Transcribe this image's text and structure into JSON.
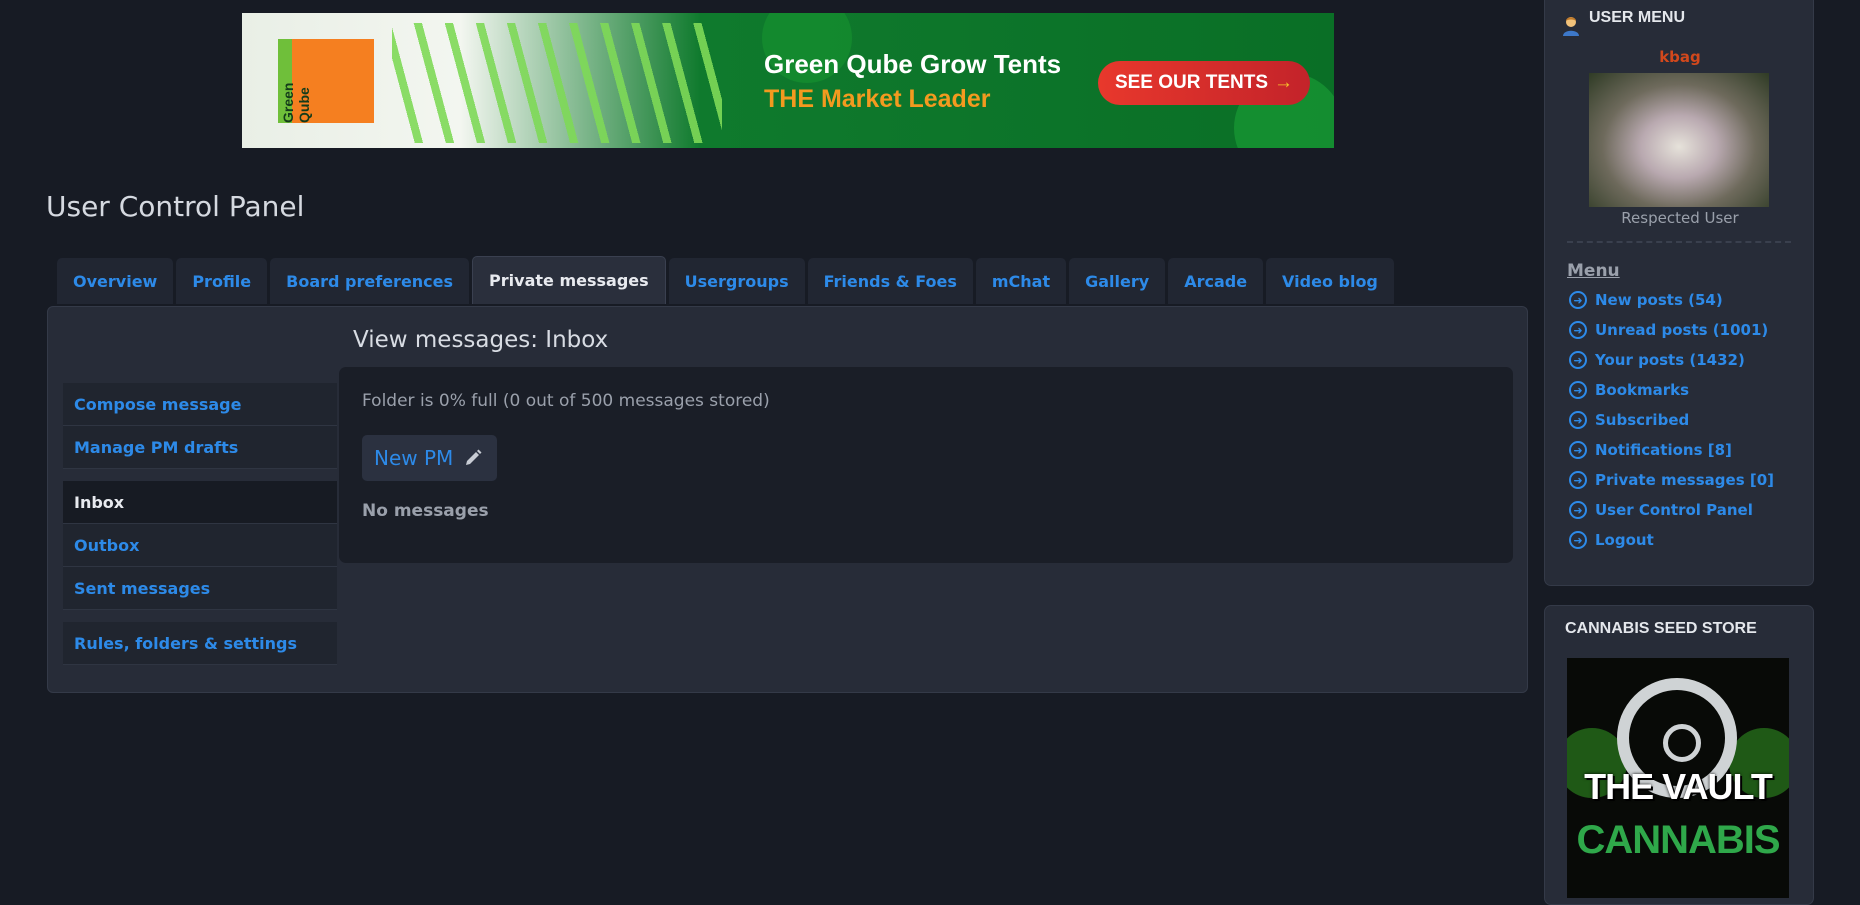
{
  "banner": {
    "logo_text": "Green Qube",
    "headline": "Green Qube Grow Tents",
    "subline": "THE Market Leader",
    "cta": "SEE OUR TENTS",
    "cta_arrow": "→"
  },
  "page": {
    "title": "User Control Panel"
  },
  "tabs": [
    {
      "label": "Overview"
    },
    {
      "label": "Profile"
    },
    {
      "label": "Board preferences"
    },
    {
      "label": "Private messages",
      "active": true
    },
    {
      "label": "Usergroups"
    },
    {
      "label": "Friends & Foes"
    },
    {
      "label": "mChat"
    },
    {
      "label": "Gallery"
    },
    {
      "label": "Arcade"
    },
    {
      "label": "Video blog"
    }
  ],
  "left_nav": {
    "group1": [
      "Compose message",
      "Manage PM drafts"
    ],
    "group2": [
      "Inbox",
      "Outbox",
      "Sent messages"
    ],
    "group3": [
      "Rules, folders & settings"
    ],
    "active": "Inbox"
  },
  "main": {
    "view_title": "View messages: Inbox",
    "folder_status": "Folder is 0% full (0 out of 500 messages stored)",
    "new_pm_label": "New PM",
    "empty_text": "No messages"
  },
  "user_menu": {
    "title": "USER MENU",
    "username": "kbag",
    "rank": "Respected User",
    "menu_heading": "Menu",
    "items": [
      "New posts (54)",
      "Unread posts (1001)",
      "Your posts (1432)",
      "Bookmarks",
      "Subscribed",
      "Notifications [8]",
      "Private messages [0]",
      "User Control Panel",
      "Logout"
    ]
  },
  "seed_store": {
    "title": "CANNABIS SEED STORE",
    "ad_line1": "THE VAULT",
    "ad_line2": "CANNABIS"
  },
  "colors": {
    "background": "#171b24",
    "link": "#2d8ae8",
    "username": "#d2481c",
    "panel": "#272c38"
  }
}
